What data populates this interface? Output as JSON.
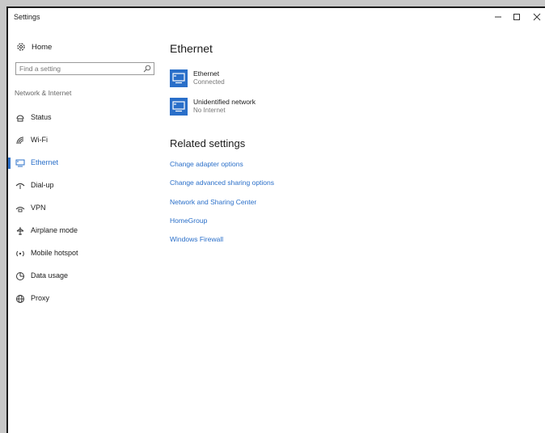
{
  "window": {
    "title": "Settings"
  },
  "sidebar": {
    "home_label": "Home",
    "search_placeholder": "Find a setting",
    "section_label": "Network & Internet",
    "items": [
      {
        "label": "Status",
        "icon": "status-icon"
      },
      {
        "label": "Wi-Fi",
        "icon": "wifi-icon"
      },
      {
        "label": "Ethernet",
        "icon": "ethernet-icon",
        "active": true
      },
      {
        "label": "Dial-up",
        "icon": "dialup-icon"
      },
      {
        "label": "VPN",
        "icon": "vpn-icon"
      },
      {
        "label": "Airplane mode",
        "icon": "airplane-icon"
      },
      {
        "label": "Mobile hotspot",
        "icon": "hotspot-icon"
      },
      {
        "label": "Data usage",
        "icon": "data-usage-icon"
      },
      {
        "label": "Proxy",
        "icon": "globe-icon"
      }
    ]
  },
  "main": {
    "title": "Ethernet",
    "networks": [
      {
        "name": "Ethernet",
        "status": "Connected"
      },
      {
        "name": "Unidentified network",
        "status": "No Internet"
      }
    ],
    "related_title": "Related settings",
    "links": [
      "Change adapter options",
      "Change advanced sharing options",
      "Network and Sharing Center",
      "HomeGroup",
      "Windows Firewall"
    ]
  },
  "colors": {
    "accent": "#2a6fc9"
  }
}
